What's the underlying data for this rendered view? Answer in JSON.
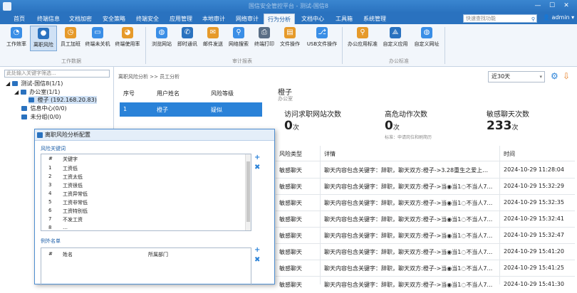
{
  "app": {
    "title": "国信安全管控平台 - 测试-国信8"
  },
  "window_controls": {
    "minimize": "—",
    "maximize": "☐",
    "close": "✕"
  },
  "menu": [
    {
      "label": "首页"
    },
    {
      "label": "终端信息"
    },
    {
      "label": "文档加密"
    },
    {
      "label": "安全策略"
    },
    {
      "label": "终端安全"
    },
    {
      "label": "应用管理"
    },
    {
      "label": "本地审计"
    },
    {
      "label": "网络审计"
    },
    {
      "label": "行为分析"
    },
    {
      "label": "文档中心"
    },
    {
      "label": "工具箱"
    },
    {
      "label": "系统管理"
    }
  ],
  "menu_active": "行为分析",
  "search": {
    "placeholder": "快速查找功能"
  },
  "user": {
    "name": "admin",
    "caret": "▾"
  },
  "ribbon": {
    "groups": [
      {
        "label": "工作数据"
      },
      {
        "label": "审计报表"
      },
      {
        "label": "办公标准"
      }
    ],
    "buttons": [
      {
        "label": "工作效率",
        "icon": "gauge-icon",
        "color": "#3a8ee6"
      },
      {
        "label": "离职风险",
        "icon": "user-risk-icon",
        "color": "#2a72bf"
      },
      {
        "label": "员工加班",
        "icon": "user-clock-icon",
        "color": "#e69a2a"
      },
      {
        "label": "终端未关机",
        "icon": "monitor-icon",
        "color": "#3a8ee6"
      },
      {
        "label": "终端使用率",
        "icon": "pie-chart-icon",
        "color": "#e69a2a"
      },
      {
        "label": "浏览网站",
        "icon": "globe-icon",
        "color": "#3a8ee6"
      },
      {
        "label": "即时通讯",
        "icon": "phone-icon",
        "color": "#2a72bf"
      },
      {
        "label": "邮件发送",
        "icon": "mail-icon",
        "color": "#e69a2a"
      },
      {
        "label": "网络搜索",
        "icon": "search-monitor-icon",
        "color": "#3a8ee6"
      },
      {
        "label": "终端打印",
        "icon": "printer-icon",
        "color": "#5a6e85"
      },
      {
        "label": "文件操作",
        "icon": "file-icon",
        "color": "#e69a2a"
      },
      {
        "label": "USB文件操作",
        "icon": "usb-icon",
        "color": "#3a8ee6"
      },
      {
        "label": "办公应用标准",
        "icon": "user-search-icon",
        "color": "#e69a2a"
      },
      {
        "label": "自定义应用",
        "icon": "compass-icon",
        "color": "#2a72bf"
      },
      {
        "label": "自定义网址",
        "icon": "globe-edit-icon",
        "color": "#3a8ee6"
      }
    ]
  },
  "tree": {
    "filter_placeholder": "此处输入关键字筛选...",
    "nodes": [
      {
        "label": "测试-国信8(1/1)"
      },
      {
        "label": "办公室(1/1)"
      },
      {
        "label": "橙子 (192.168.20.83)"
      },
      {
        "label": "信息中心(0/0)"
      },
      {
        "label": "未分组(0/0)"
      }
    ]
  },
  "breadcrumb": "离职风险分析 >> 员工分析",
  "range": {
    "value": "近30天",
    "caret": "▾"
  },
  "actions": {
    "settings_icon": "⚙",
    "export_icon": "⇩"
  },
  "employee_table": {
    "headers": [
      "序号",
      "用户姓名",
      "风险等级"
    ],
    "rows": [
      {
        "no": "1",
        "name": "橙子",
        "level": "疑似"
      }
    ]
  },
  "detail": {
    "name": "橙子",
    "dept": "办公室",
    "stats": [
      {
        "title": "访问求职网站次数",
        "value": "0",
        "unit": "次",
        "note": ""
      },
      {
        "title": "高危动作次数",
        "value": "0",
        "unit": "次",
        "note": "标准：申请岗位和刷简历"
      },
      {
        "title": "敏感聊天次数",
        "value": "233",
        "unit": "次",
        "note": ""
      }
    ]
  },
  "records": {
    "headers": [
      "风险类型",
      "详情",
      "时间"
    ],
    "rows": [
      {
        "type": "敏感聊天",
        "detail": "聊天内容包含关键字：辞职，聊天双方:橙子->3.28重生之爱上…",
        "time": "2024-10-29 11:28:04"
      },
      {
        "type": "敏感聊天",
        "detail": "聊天内容包含关键字：辞职，聊天双方:橙子->当◉当1◌不当人7…",
        "time": "2024-10-29 15:32:29"
      },
      {
        "type": "敏感聊天",
        "detail": "聊天内容包含关键字：辞职，聊天双方:橙子->当◉当1◌不当人7…",
        "time": "2024-10-29 15:32:35"
      },
      {
        "type": "敏感聊天",
        "detail": "聊天内容包含关键字：辞职，聊天双方:橙子->当◉当1◌不当人7…",
        "time": "2024-10-29 15:32:41"
      },
      {
        "type": "敏感聊天",
        "detail": "聊天内容包含关键字：辞职，聊天双方:橙子->当◉当1◌不当人7…",
        "time": "2024-10-29 15:32:47"
      },
      {
        "type": "敏感聊天",
        "detail": "聊天内容包含关键字：辞职，聊天双方:橙子->当◉当1◌不当人7…",
        "time": "2024-10-29 15:41:20"
      },
      {
        "type": "敏感聊天",
        "detail": "聊天内容包含关键字：辞职，聊天双方:橙子->当◉当1◌不当人7…",
        "time": "2024-10-29 15:41:25"
      },
      {
        "type": "敏感聊天",
        "detail": "聊天内容包含关键字：辞职，聊天双方:橙子->当◉当1◌不当人7…",
        "time": "2024-10-29 15:41:30"
      }
    ]
  },
  "dialog": {
    "title": "离职风险分析配置",
    "keywords_title": "风险关键词",
    "keywords_headers": [
      "#",
      "关键字"
    ],
    "keywords": [
      {
        "no": "1",
        "word": "工资低"
      },
      {
        "no": "2",
        "word": "工资太低"
      },
      {
        "no": "3",
        "word": "工资很低"
      },
      {
        "no": "4",
        "word": "工资异常低"
      },
      {
        "no": "5",
        "word": "工资非常低"
      },
      {
        "no": "6",
        "word": "工资特别低"
      },
      {
        "no": "7",
        "word": "不发工资"
      },
      {
        "no": "8",
        "word": "…"
      }
    ],
    "exceptions_title": "例外名单",
    "exceptions_headers": [
      "#",
      "姓名",
      "所属部门"
    ],
    "add_icon": "+",
    "remove_icon": "✖"
  }
}
